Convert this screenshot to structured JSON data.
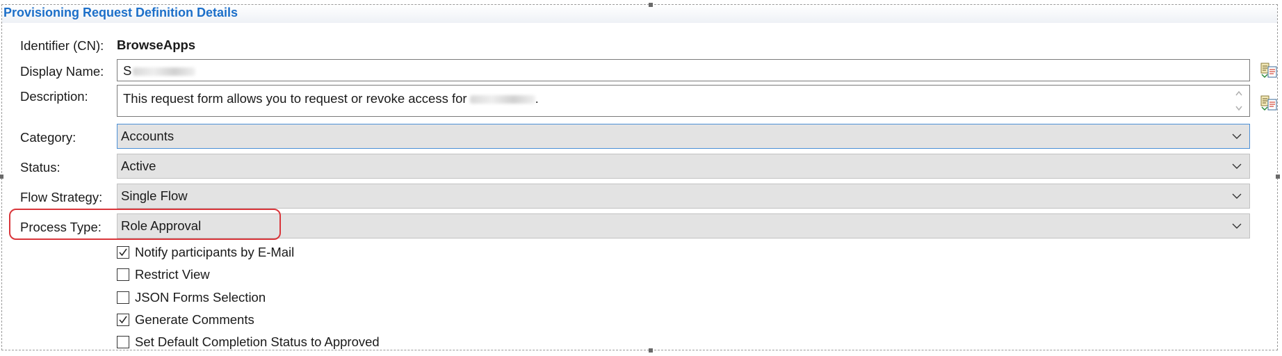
{
  "section_title": "Provisioning Request Definition Details",
  "fields": {
    "identifier": {
      "label": "Identifier (CN):",
      "value": "BrowseApps"
    },
    "display_name": {
      "label": "Display Name:",
      "value": "S"
    },
    "description": {
      "label": "Description:",
      "value": "This request form allows you to request or revoke access for"
    },
    "category": {
      "label": "Category:",
      "value": "Accounts"
    },
    "status": {
      "label": "Status:",
      "value": "Active"
    },
    "flow_strategy": {
      "label": "Flow Strategy:",
      "value": "Single Flow"
    },
    "process_type": {
      "label": "Process Type:",
      "value": "Role Approval"
    }
  },
  "options": [
    {
      "label": "Notify participants by E-Mail",
      "checked": true
    },
    {
      "label": "Restrict View",
      "checked": false
    },
    {
      "label": "JSON Forms Selection",
      "checked": false
    },
    {
      "label": "Generate Comments",
      "checked": true
    },
    {
      "label": "Set Default Completion Status to Approved",
      "checked": false
    }
  ],
  "icons": {
    "translate": "translate-icon",
    "dropdown": "chevron-down-icon"
  },
  "colors": {
    "title": "#1c6fc9",
    "highlight": "#d9353a",
    "combo_bg": "#e3e3e3"
  }
}
